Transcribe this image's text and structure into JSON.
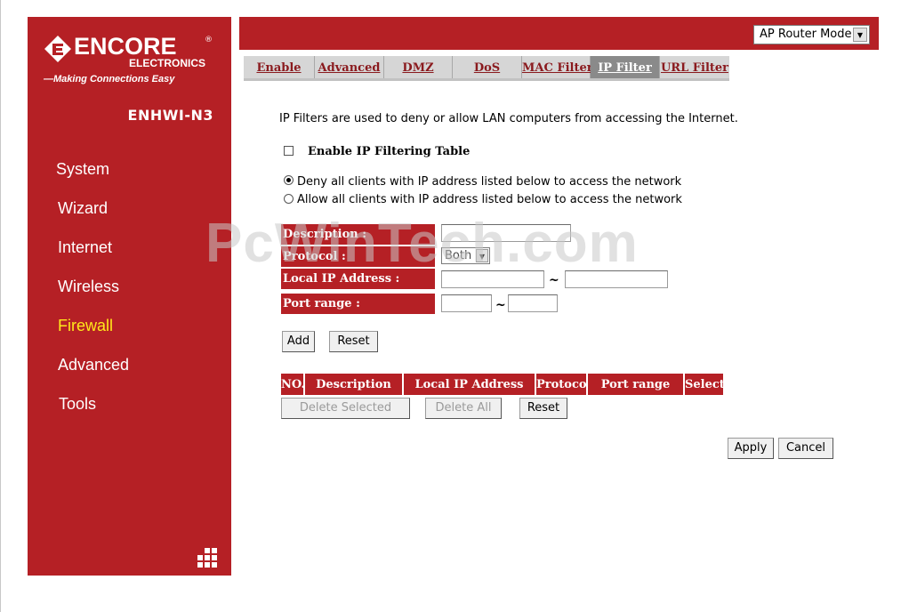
{
  "sidebar": {
    "brand": "ENCORE",
    "registered": "®",
    "brand_sub": "ELECTRONICS",
    "tagline": "—Making Connections Easy",
    "model": "ENHWI-N3",
    "items": [
      {
        "label": "System",
        "active": false
      },
      {
        "label": "Wizard",
        "active": false
      },
      {
        "label": "Internet",
        "active": false
      },
      {
        "label": "Wireless",
        "active": false
      },
      {
        "label": "Firewall",
        "active": true
      },
      {
        "label": "Advanced",
        "active": false
      },
      {
        "label": "Tools",
        "active": false
      }
    ]
  },
  "header": {
    "mode_value": "AP Router Mode"
  },
  "tabs": [
    {
      "label": "Enable",
      "active": false
    },
    {
      "label": "Advanced",
      "active": false
    },
    {
      "label": "DMZ",
      "active": false
    },
    {
      "label": "DoS",
      "active": false
    },
    {
      "label": "MAC Filter",
      "active": false
    },
    {
      "label": "IP Filter",
      "active": true
    },
    {
      "label": "URL Filter",
      "active": false
    }
  ],
  "content": {
    "intro": "IP Filters are used to deny or allow LAN computers from accessing the Internet.",
    "enable_label": "Enable IP Filtering Table",
    "enable_checked": false,
    "deny_label": "Deny all clients with IP address listed below to access the network",
    "allow_label": "Allow all clients with IP address listed below to access the network",
    "deny_selected": true,
    "form": {
      "description_label": "Description :",
      "protocol_label": "Protocol :",
      "protocol_value": "Both",
      "local_ip_label": "Local IP Address :",
      "port_range_label": "Port range :",
      "tilde": "~"
    },
    "add_button": "Add",
    "reset_button": "Reset",
    "table_headers": [
      "NO.",
      "Description",
      "Local IP Address",
      "Protocol",
      "Port range",
      "Select"
    ],
    "delete_selected_button": "Delete Selected",
    "delete_all_button": "Delete All",
    "table_reset_button": "Reset",
    "apply_button": "Apply",
    "cancel_button": "Cancel"
  },
  "watermark": "PcWinTech.com",
  "colors": {
    "brand_red": "#b52025",
    "active_nav": "#ffe81a",
    "tab_text": "#8a1a1e"
  }
}
